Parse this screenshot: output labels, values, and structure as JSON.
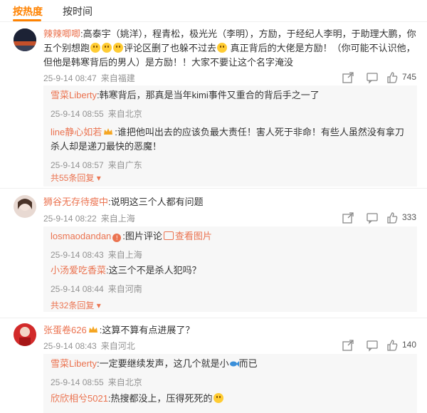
{
  "tabs": {
    "hot": "按热度",
    "time": "按时间"
  },
  "comments": [
    {
      "user": "辣辣唧唧",
      "text_a": ":高泰宇（姚洋），程青松，极光光（李明），方励，于经纪人李明，于助理大鹏，你五个别想跑",
      "text_b": "评论区删了也躲不过去",
      "text_c": " 真正背后的大佬是方励！（你可能不认识他，但他是韩寒背后的男人）是方励！！大家不要让这个名字淹没",
      "time": "25-9-14 08:47",
      "location": "来自福建",
      "likes": "745",
      "replies": [
        {
          "user": "雪菜Liberty",
          "text": ":韩寒背后，那真是当年kimi事件又重合的背后手之一了",
          "time": "25-9-14 08:55",
          "location": "来自北京"
        },
        {
          "user": "line静心如若",
          "text": ":谁把他叫出去的应该负最大责任！害人死于非命！有些人虽然没有拿刀杀人却是递刀最快的恶魔！",
          "time": "25-9-14 08:57",
          "location": "来自广东"
        }
      ],
      "more": "共55条回复"
    },
    {
      "user": "狮谷无存待瘦中",
      "text": ":说明这三个人都有问题",
      "time": "25-9-14 08:22",
      "location": "来自上海",
      "likes": "333",
      "replies": [
        {
          "user": "losmaodandan",
          "text": ":图片评论",
          "link": "查看图片",
          "time": "25-9-14 08:43",
          "location": "来自上海"
        },
        {
          "user": "小汤爱吃香菜",
          "text": ":这三个不是杀人犯吗？",
          "time": "25-9-14 08:44",
          "location": "来自河南"
        }
      ],
      "more": "共32条回复"
    },
    {
      "user": "张蛋卷626",
      "text": ":这算不算有点进展了？",
      "time": "25-9-14 08:43",
      "location": "来自河北",
      "likes": "140",
      "replies": [
        {
          "user": "雪菜Liberty",
          "text_a": ":一定要继续发声，这几个就是小",
          "text_b": "而已",
          "time": "25-9-14 08:55",
          "location": "来自北京"
        },
        {
          "user": "欣欣相兮5021",
          "text": ":热搜都没上，压得死死的"
        }
      ]
    }
  ]
}
